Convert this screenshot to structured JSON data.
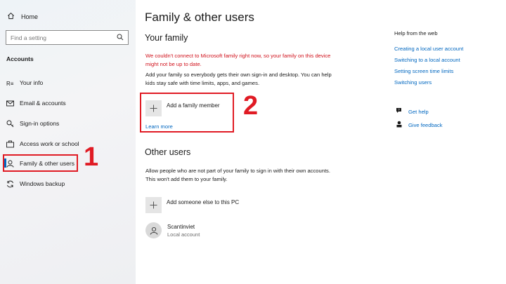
{
  "sidebar": {
    "home_label": "Home",
    "search_placeholder": "Find a setting",
    "section_title": "Accounts",
    "items": [
      {
        "label": "Your info",
        "icon": "your-info-icon"
      },
      {
        "label": "Email & accounts",
        "icon": "mail-icon"
      },
      {
        "label": "Sign-in options",
        "icon": "key-icon"
      },
      {
        "label": "Access work or school",
        "icon": "briefcase-icon"
      },
      {
        "label": "Family & other users",
        "icon": "person-icon",
        "active": true
      },
      {
        "label": "Windows backup",
        "icon": "sync-icon"
      }
    ]
  },
  "annotations": {
    "marker_1": "1",
    "marker_2": "2",
    "color": "#e01b24"
  },
  "main": {
    "title": "Family & other users",
    "your_family": {
      "heading": "Your family",
      "error": "We couldn't connect to Microsoft family right now, so your family on this device might not be up to date.",
      "description": "Add your family so everybody gets their own sign-in and desktop. You can help kids stay safe with time limits, apps, and games.",
      "add_label": "Add a family member",
      "learn_more": "Learn more"
    },
    "other_users": {
      "heading": "Other users",
      "description": "Allow people who are not part of your family to sign in with their own accounts. This won't add them to your family.",
      "add_label": "Add someone else to this PC",
      "user_name": "Scantinviet",
      "user_type": "Local account"
    }
  },
  "help": {
    "title": "Help from the web",
    "links": [
      "Creating a local user account",
      "Switching to a local account",
      "Setting screen time limits",
      "Switching users"
    ],
    "get_help": "Get help",
    "give_feedback": "Give feedback"
  },
  "colors": {
    "accent": "#0067c0",
    "error": "#d0101a"
  }
}
